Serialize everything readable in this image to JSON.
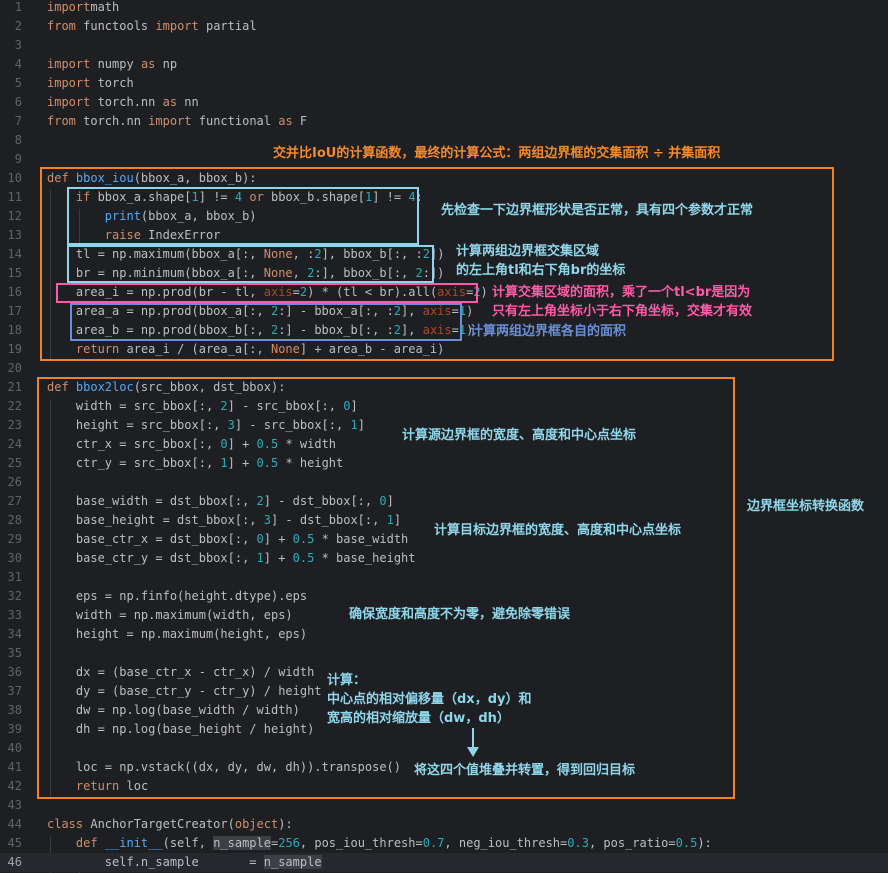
{
  "colors": {
    "background": "#1e1f22",
    "text": "#bcbec4",
    "keyword": "#cf8e6d",
    "function": "#56a8f5",
    "number": "#2aacb8",
    "orange_box": "#f0822a",
    "cyan_box": "#8fd6ea",
    "magenta_box": "#ff5aa8",
    "blue_box": "#6a8fd8",
    "annotation_orange": "#f28a2e",
    "annotation_cyan": "#8fd6ea",
    "annotation_magenta": "#ff5aa8",
    "annotation_blue": "#6a8fd8"
  },
  "current_line": 46,
  "code_lines": [
    {
      "n": 1,
      "tokens": [
        [
          "kw",
          "import"
        ],
        [
          "",
          "math"
        ]
      ]
    },
    {
      "n": 2,
      "tokens": [
        [
          "kw",
          "from"
        ],
        [
          "",
          " functools "
        ],
        [
          "kw",
          "import"
        ],
        [
          "",
          " partial"
        ]
      ]
    },
    {
      "n": 3,
      "tokens": []
    },
    {
      "n": 4,
      "tokens": [
        [
          "kw",
          "import"
        ],
        [
          "",
          " numpy "
        ],
        [
          "kw",
          "as"
        ],
        [
          "",
          " np"
        ]
      ]
    },
    {
      "n": 5,
      "tokens": [
        [
          "kw",
          "import"
        ],
        [
          "",
          " torch"
        ]
      ]
    },
    {
      "n": 6,
      "tokens": [
        [
          "kw",
          "import"
        ],
        [
          "",
          " torch.nn "
        ],
        [
          "kw",
          "as"
        ],
        [
          "",
          " nn"
        ]
      ]
    },
    {
      "n": 7,
      "tokens": [
        [
          "kw",
          "from"
        ],
        [
          "",
          " torch.nn "
        ],
        [
          "kw",
          "import"
        ],
        [
          "",
          " functional "
        ],
        [
          "kw",
          "as"
        ],
        [
          "",
          " F"
        ]
      ]
    },
    {
      "n": 8,
      "tokens": []
    },
    {
      "n": 9,
      "tokens": []
    },
    {
      "n": 10,
      "tokens": [
        [
          "kw",
          "def "
        ],
        [
          "fn",
          "bbox_iou"
        ],
        [
          "",
          "(bbox_a, bbox_b):"
        ]
      ]
    },
    {
      "n": 11,
      "tokens": [
        [
          "",
          "    "
        ],
        [
          "kw",
          "if"
        ],
        [
          "",
          " bbox_a.shape["
        ],
        [
          "num",
          "1"
        ],
        [
          "",
          "] != "
        ],
        [
          "num",
          "4"
        ],
        [
          "",
          " "
        ],
        [
          "kw",
          "or"
        ],
        [
          "",
          " bbox_b.shape["
        ],
        [
          "num",
          "1"
        ],
        [
          "",
          "] != "
        ],
        [
          "num",
          "4"
        ],
        [
          "",
          ":"
        ]
      ]
    },
    {
      "n": 12,
      "tokens": [
        [
          "",
          "        "
        ],
        [
          "fn",
          "print"
        ],
        [
          "",
          "(bbox_a, bbox_b)"
        ]
      ]
    },
    {
      "n": 13,
      "tokens": [
        [
          "",
          "        "
        ],
        [
          "kw",
          "raise"
        ],
        [
          "",
          " IndexError"
        ]
      ]
    },
    {
      "n": 14,
      "tokens": [
        [
          "",
          "    tl = np.maximum(bbox_a[:, "
        ],
        [
          "kw",
          "None"
        ],
        [
          "",
          ", :"
        ],
        [
          "num",
          "2"
        ],
        [
          "",
          "], bbox_b[:, :"
        ],
        [
          "num",
          "2"
        ],
        [
          "",
          "])"
        ]
      ]
    },
    {
      "n": 15,
      "tokens": [
        [
          "",
          "    br = np.minimum(bbox_a[:, "
        ],
        [
          "kw",
          "None"
        ],
        [
          "",
          ", "
        ],
        [
          "num",
          "2"
        ],
        [
          "",
          ":], bbox_b[:, "
        ],
        [
          "num",
          "2"
        ],
        [
          "",
          ":])"
        ]
      ]
    },
    {
      "n": 16,
      "tokens": [
        [
          "",
          "    area_i = np.prod(br - tl, "
        ],
        [
          "pn",
          "axis"
        ],
        [
          "",
          "="
        ],
        [
          "num",
          "2"
        ],
        [
          "",
          ") * (tl < br).all("
        ],
        [
          "pn",
          "axis"
        ],
        [
          "",
          "="
        ],
        [
          "num",
          "2"
        ],
        [
          "",
          ")"
        ]
      ]
    },
    {
      "n": 17,
      "tokens": [
        [
          "",
          "    area_a = np.prod(bbox_a[:, "
        ],
        [
          "num",
          "2"
        ],
        [
          "",
          ":] - bbox_a[:, :"
        ],
        [
          "num",
          "2"
        ],
        [
          "",
          "], "
        ],
        [
          "pn",
          "axis"
        ],
        [
          "",
          "="
        ],
        [
          "num",
          "1"
        ],
        [
          "",
          ")"
        ]
      ]
    },
    {
      "n": 18,
      "tokens": [
        [
          "",
          "    area_b = np.prod(bbox_b[:, "
        ],
        [
          "num",
          "2"
        ],
        [
          "",
          ":] - bbox_b[:, :"
        ],
        [
          "num",
          "2"
        ],
        [
          "",
          "], "
        ],
        [
          "pn",
          "axis"
        ],
        [
          "",
          "="
        ],
        [
          "num",
          "1"
        ],
        [
          "",
          ")"
        ]
      ]
    },
    {
      "n": 19,
      "tokens": [
        [
          "",
          "    "
        ],
        [
          "kw",
          "return"
        ],
        [
          "",
          " area_i / (area_a[:, "
        ],
        [
          "kw",
          "None"
        ],
        [
          "",
          "] + area_b - area_i)"
        ]
      ]
    },
    {
      "n": 20,
      "tokens": []
    },
    {
      "n": 21,
      "tokens": [
        [
          "kw",
          "def "
        ],
        [
          "fn",
          "bbox2loc"
        ],
        [
          "",
          "(src_bbox, dst_bbox):"
        ]
      ]
    },
    {
      "n": 22,
      "tokens": [
        [
          "",
          "    width = src_bbox[:, "
        ],
        [
          "num",
          "2"
        ],
        [
          "",
          "] - src_bbox[:, "
        ],
        [
          "num",
          "0"
        ],
        [
          "",
          "]"
        ]
      ]
    },
    {
      "n": 23,
      "tokens": [
        [
          "",
          "    height = src_bbox[:, "
        ],
        [
          "num",
          "3"
        ],
        [
          "",
          "] - src_bbox[:, "
        ],
        [
          "num",
          "1"
        ],
        [
          "",
          "]"
        ]
      ]
    },
    {
      "n": 24,
      "tokens": [
        [
          "",
          "    ctr_x = src_bbox[:, "
        ],
        [
          "num",
          "0"
        ],
        [
          "",
          "] + "
        ],
        [
          "num",
          "0.5"
        ],
        [
          "",
          " * width"
        ]
      ]
    },
    {
      "n": 25,
      "tokens": [
        [
          "",
          "    ctr_y = src_bbox[:, "
        ],
        [
          "num",
          "1"
        ],
        [
          "",
          "] + "
        ],
        [
          "num",
          "0.5"
        ],
        [
          "",
          " * height"
        ]
      ]
    },
    {
      "n": 26,
      "tokens": []
    },
    {
      "n": 27,
      "tokens": [
        [
          "",
          "    base_width = dst_bbox[:, "
        ],
        [
          "num",
          "2"
        ],
        [
          "",
          "] - dst_bbox[:, "
        ],
        [
          "num",
          "0"
        ],
        [
          "",
          "]"
        ]
      ]
    },
    {
      "n": 28,
      "tokens": [
        [
          "",
          "    base_height = dst_bbox[:, "
        ],
        [
          "num",
          "3"
        ],
        [
          "",
          "] - dst_bbox[:, "
        ],
        [
          "num",
          "1"
        ],
        [
          "",
          "]"
        ]
      ]
    },
    {
      "n": 29,
      "tokens": [
        [
          "",
          "    base_ctr_x = dst_bbox[:, "
        ],
        [
          "num",
          "0"
        ],
        [
          "",
          "] + "
        ],
        [
          "num",
          "0.5"
        ],
        [
          "",
          " * base_width"
        ]
      ]
    },
    {
      "n": 30,
      "tokens": [
        [
          "",
          "    base_ctr_y = dst_bbox[:, "
        ],
        [
          "num",
          "1"
        ],
        [
          "",
          "] + "
        ],
        [
          "num",
          "0.5"
        ],
        [
          "",
          " * base_height"
        ]
      ]
    },
    {
      "n": 31,
      "tokens": []
    },
    {
      "n": 32,
      "tokens": [
        [
          "",
          "    eps = np.finfo(height.dtype).eps"
        ]
      ]
    },
    {
      "n": 33,
      "tokens": [
        [
          "",
          "    width = np.maximum(width, eps)"
        ]
      ]
    },
    {
      "n": 34,
      "tokens": [
        [
          "",
          "    height = np.maximum(height, eps)"
        ]
      ]
    },
    {
      "n": 35,
      "tokens": []
    },
    {
      "n": 36,
      "tokens": [
        [
          "",
          "    dx = (base_ctr_x - ctr_x) / width"
        ]
      ]
    },
    {
      "n": 37,
      "tokens": [
        [
          "",
          "    dy = (base_ctr_y - ctr_y) / height"
        ]
      ]
    },
    {
      "n": 38,
      "tokens": [
        [
          "",
          "    dw = np.log(base_width / width)"
        ]
      ]
    },
    {
      "n": 39,
      "tokens": [
        [
          "",
          "    dh = np.log(base_height / height)"
        ]
      ]
    },
    {
      "n": 40,
      "tokens": []
    },
    {
      "n": 41,
      "tokens": [
        [
          "",
          "    loc = np.vstack((dx, dy, dw, dh)).transpose()"
        ]
      ]
    },
    {
      "n": 42,
      "tokens": [
        [
          "",
          "    "
        ],
        [
          "kw",
          "return"
        ],
        [
          "",
          " loc"
        ]
      ]
    },
    {
      "n": 43,
      "tokens": []
    },
    {
      "n": 44,
      "tokens": [
        [
          "kw",
          "class "
        ],
        [
          "",
          "AnchorTargetCreator("
        ],
        [
          "kw",
          "object"
        ],
        [
          "",
          "):"
        ]
      ]
    },
    {
      "n": 45,
      "tokens": [
        [
          "",
          "    "
        ],
        [
          "kw",
          "def "
        ],
        [
          "fn",
          "__init__"
        ],
        [
          "",
          "(self, "
        ],
        [
          "hi",
          "n_sample"
        ],
        [
          "",
          "="
        ],
        [
          "num",
          "256"
        ],
        [
          "",
          ", pos_iou_thresh="
        ],
        [
          "num",
          "0.7"
        ],
        [
          "",
          ", neg_iou_thresh="
        ],
        [
          "num",
          "0.3"
        ],
        [
          "",
          ", pos_ratio="
        ],
        [
          "num",
          "0.5"
        ],
        [
          "",
          "):"
        ]
      ]
    },
    {
      "n": 46,
      "tokens": [
        [
          "",
          "        self.n_sample       = "
        ],
        [
          "hi",
          "n_sample"
        ]
      ]
    }
  ],
  "annotations": {
    "title": "交并比IoU的计算函数，最终的计算公式：两组边界框的交集面积 ÷ 并集面积",
    "shape_check": "先检查一下边界框形状是否正常，具有四个参数才正常",
    "intersection_region_1": "计算两组边界框交集区域",
    "intersection_region_2": "的左上角tl和右下角br的坐标",
    "intersection_area_1": "计算交集区域的面积，乘了一个tl<br是因为",
    "intersection_area_2": "只有左上角坐标小于右下角坐标，交集才有效",
    "each_area": "计算两组边界框各自的面积",
    "src_box": "计算源边界框的宽度、高度和中心点坐标",
    "dst_box": "计算目标边界框的宽度、高度和中心点坐标",
    "func_label": "边界框坐标转换函数",
    "eps_note": "确保宽度和高度不为零，避免除零错误",
    "calc_1": "计算：",
    "calc_2": "中心点的相对偏移量（dx，dy）和",
    "calc_3": "宽高的相对缩放量（dw，dh）",
    "stack_note": "将这四个值堆叠并转置，得到回归目标"
  }
}
